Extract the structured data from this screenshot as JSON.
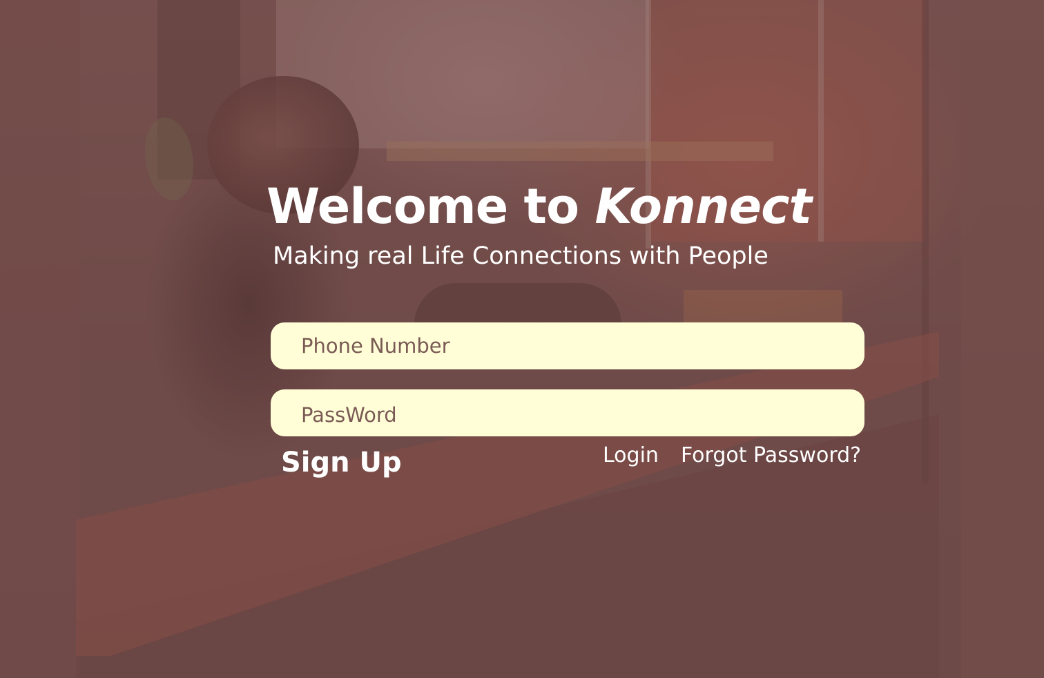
{
  "header": {
    "title_prefix": "Welcome to",
    "title_brand": "Konnect",
    "subtitle": "Making real Life Connections with People"
  },
  "form": {
    "phone": {
      "placeholder": "Phone Number",
      "value": ""
    },
    "password": {
      "placeholder": "PassWord",
      "value": ""
    }
  },
  "actions": {
    "signup_label": "Sign Up",
    "login_label": "Login",
    "forgot_label": "Forgot Password?"
  },
  "colors": {
    "overlay": "#6f4a48",
    "input_background": "#fffed6",
    "input_text": "#7a5a55",
    "text": "#ffffff"
  }
}
